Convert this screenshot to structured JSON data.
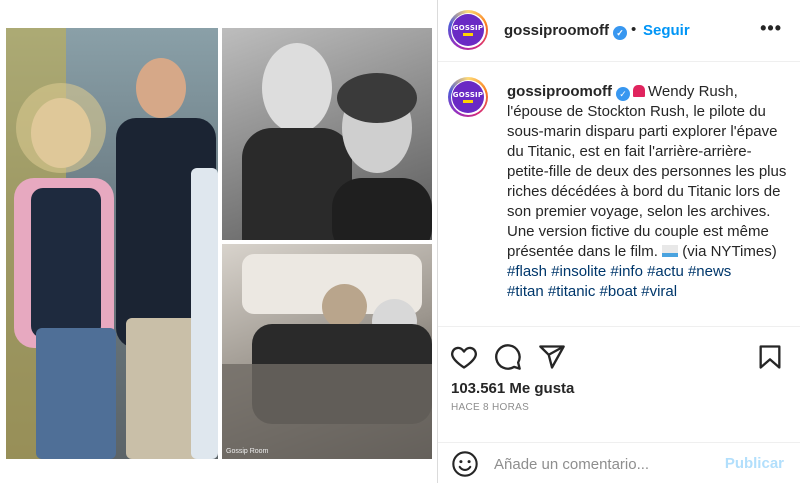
{
  "post": {
    "watermark": "Gossip Room"
  },
  "header": {
    "avatar_text": "GOSSIP",
    "username": "gossiproomoff",
    "separator": "•",
    "follow_label": "Seguir",
    "more_label": "•••"
  },
  "caption": {
    "username": "gossiproomoff",
    "text": "Wendy Rush, l'épouse de Stockton Rush, le pilote du sous-marin disparu parti explorer l'épave du Titanic, est en fait l'arrière-arrière-petite-fille de deux des personnes les plus riches décédées à bord du Titanic lors de son premier voyage, selon les archives.",
    "text2": "Une version fictive du couple est même présentée dans le film.",
    "text3": "(via NYTimes)",
    "hashtags": "#flash #insolite #info #actu #news",
    "hashtags_more": "#titan #titanic #boat #viral"
  },
  "engagement": {
    "likes": "103.561 Me gusta",
    "time": "HACE 8 HORAS"
  },
  "comment": {
    "placeholder": "Añade un comentario...",
    "publish_label": "Publicar"
  },
  "icons": [
    "heart-icon",
    "comment-icon",
    "share-icon",
    "bookmark-icon",
    "emoji-icon",
    "verified-icon",
    "siren-icon",
    "ship-icon"
  ],
  "colors": {
    "accent": "#0095f6",
    "publish_disabled": "#b2dffc",
    "hashtag": "#00376b",
    "verified": "#3897f0",
    "avatar_bg": "#6a2ac4"
  }
}
